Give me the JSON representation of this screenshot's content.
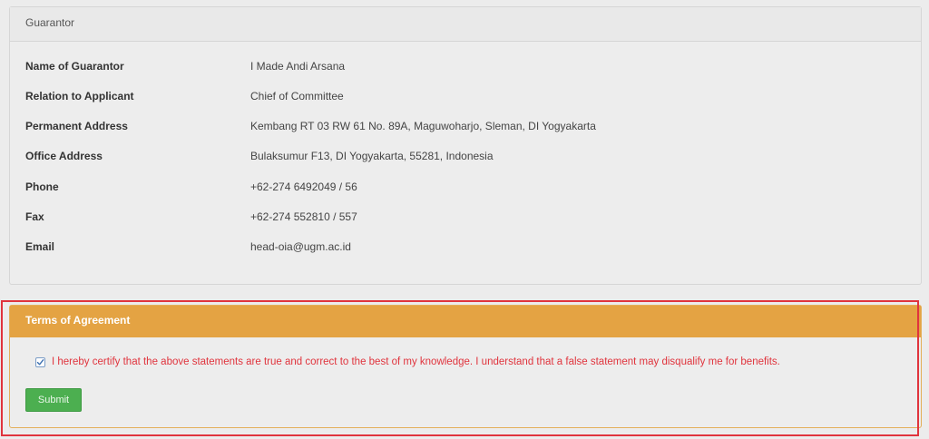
{
  "guarantor": {
    "title": "Guarantor",
    "rows": [
      {
        "label": "Name of Guarantor",
        "value": "I Made Andi Arsana"
      },
      {
        "label": "Relation to Applicant",
        "value": "Chief of Committee"
      },
      {
        "label": "Permanent Address",
        "value": "Kembang RT 03 RW 61 No. 89A, Maguwoharjo, Sleman, DI Yogyakarta"
      },
      {
        "label": "Office Address",
        "value": "Bulaksumur F13, DI Yogyakarta, 55281, Indonesia"
      },
      {
        "label": "Phone",
        "value": "+62-274 6492049 / 56"
      },
      {
        "label": "Fax",
        "value": "+62-274 552810 / 557"
      },
      {
        "label": "Email",
        "value": "head-oia@ugm.ac.id"
      }
    ]
  },
  "terms": {
    "title": "Terms of Agreement",
    "checkbox_checked": true,
    "statement": "I hereby certify that the above statements are true and correct to the best of my knowledge. I understand that a false statement may disqualify me for benefits.",
    "submit_label": "Submit"
  },
  "colors": {
    "terms_header": "#e4a343",
    "highlight_border": "#e0343d",
    "statement_text": "#e0343d",
    "submit_button": "#4caf50"
  }
}
